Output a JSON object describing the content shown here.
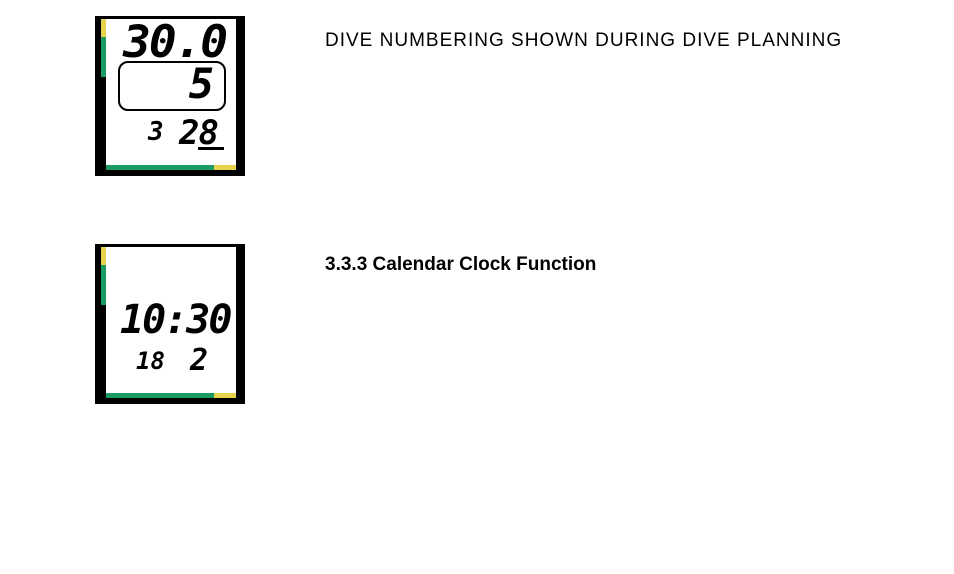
{
  "section1": {
    "lcd": {
      "top": "30.0",
      "box": "5",
      "row3_left": "3",
      "row3_right": "28"
    },
    "caption": "DIVE NUMBERING SHOWN DURING DIVE PLANNING"
  },
  "section2": {
    "lcd": {
      "time": "10:30",
      "row3_left": "18",
      "row3_right": "2"
    },
    "heading": "3.3.3 Calendar Clock Function"
  }
}
